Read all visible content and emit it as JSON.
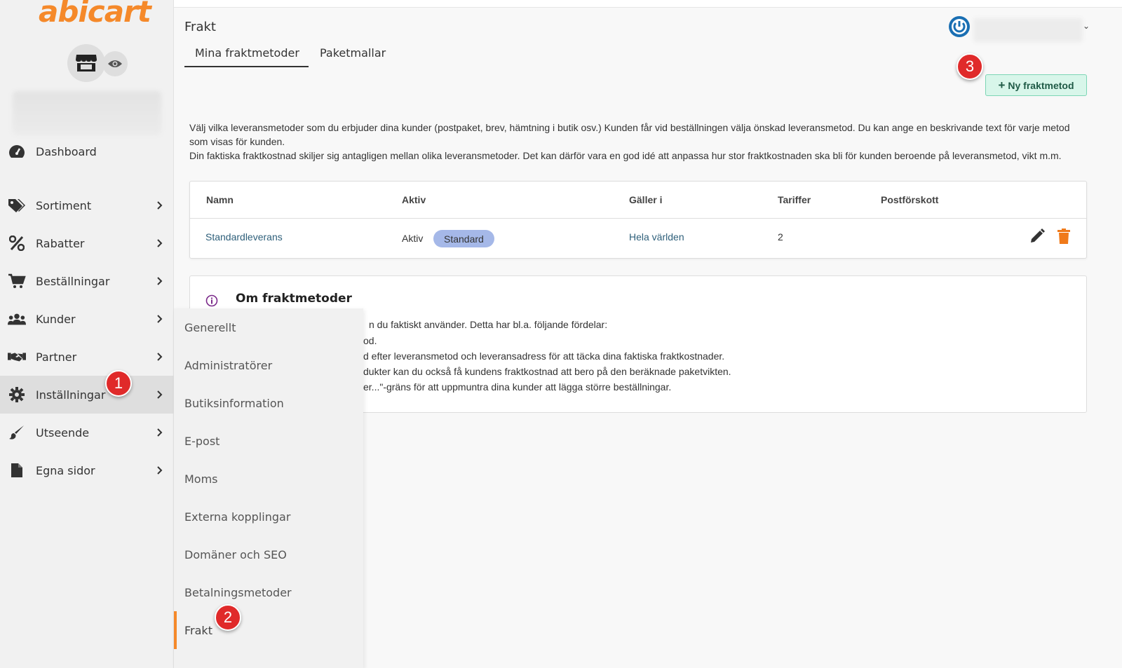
{
  "brand": {
    "logo_text": "abicart",
    "accent": "#f5892a"
  },
  "sidebar": {
    "items": [
      {
        "label": "Dashboard",
        "icon": "gauge-icon"
      },
      {
        "label": "Sortiment",
        "icon": "tags-icon"
      },
      {
        "label": "Rabatter",
        "icon": "percent-icon"
      },
      {
        "label": "Beställningar",
        "icon": "cart-icon"
      },
      {
        "label": "Kunder",
        "icon": "users-icon"
      },
      {
        "label": "Partner",
        "icon": "handshake-icon"
      },
      {
        "label": "Inställningar",
        "icon": "gear-icon"
      },
      {
        "label": "Utseende",
        "icon": "brush-icon"
      },
      {
        "label": "Egna sidor",
        "icon": "file-icon"
      }
    ]
  },
  "submenu": {
    "items": [
      "Generellt",
      "Administratörer",
      "Butiksinformation",
      "E-post",
      "Moms",
      "Externa kopplingar",
      "Domäner och SEO",
      "Betalningsmetoder",
      "Frakt"
    ],
    "active": "Frakt"
  },
  "badges": {
    "one": "1",
    "two": "2",
    "three": "3"
  },
  "header": {
    "title": "Frakt",
    "tabs": [
      "Mina fraktmetoder",
      "Paketmallar"
    ]
  },
  "toolbar": {
    "new_label": "Ny fraktmetod",
    "new_plus": "+"
  },
  "description": {
    "line1": "Välj vilka leveransmetoder som du erbjuder dina kunder (postpaket, brev, hämtning i butik osv.) Kunden får vid beställningen välja önskad leveransmetod. Du kan ange en beskrivande text för varje metod som visas för kunden.",
    "line2": "Din faktiska fraktkostnad skiljer sig antagligen mellan olika leveransmetoder. Det kan därför vara en god idé att anpassa hur stor fraktkostnaden ska bli för kunden beroende på leveransmetod, vikt m.m."
  },
  "table": {
    "headers": {
      "name": "Namn",
      "active": "Aktiv",
      "applies": "Gäller i",
      "tariffs": "Tariffer",
      "cod": "Postförskott"
    },
    "row": {
      "name": "Standardleverans",
      "active": "Aktiv",
      "standard_badge": "Standard",
      "applies": "Hela världen",
      "tariffs": "2",
      "cod": ""
    }
  },
  "info": {
    "title": "Om fraktmetoder",
    "lines": [
      "n du faktiskt använder. Detta har bl.a. följande fördelar:",
      "od.",
      "d efter leveransmetod och leveransadress för att täcka dina faktiska fraktkostnader.",
      "dukter kan du också få kundens fraktkostnad att bero på den beräknade paketvikten.",
      "er...\"-gräns för att uppmuntra dina kunder att lägga större beställningar."
    ]
  },
  "colors": {
    "primary_badge": "#e02a2a",
    "new_btn_bg": "#d8f6ea",
    "link": "#2e5f7a",
    "power": "#1a6fb3"
  }
}
